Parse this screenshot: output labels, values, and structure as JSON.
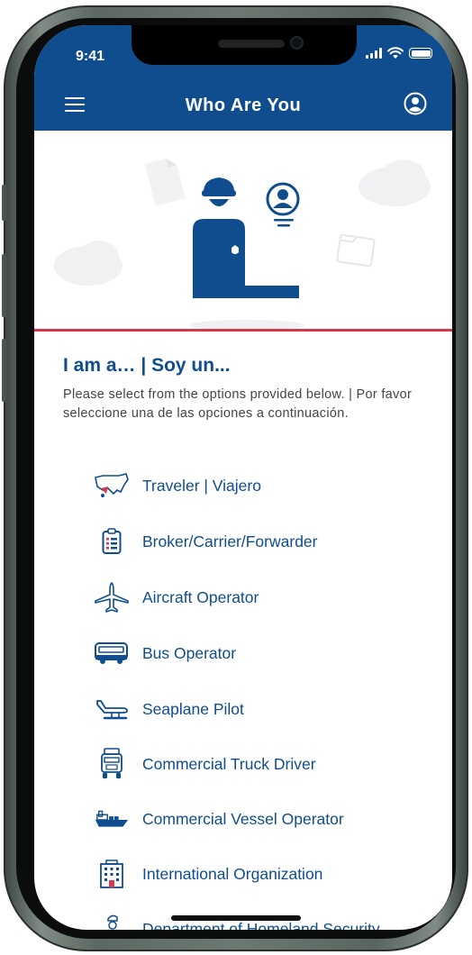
{
  "status_bar": {
    "time": "9:41"
  },
  "header": {
    "title": "Who Are You"
  },
  "section": {
    "title": "I am a… | Soy un...",
    "description": "Please select from the options provided below. | Por favor seleccione una de las opciones a continuación."
  },
  "options": [
    {
      "label": "Traveler | Viajero",
      "icon": "us-map-icon"
    },
    {
      "label": "Broker/Carrier/Forwarder",
      "icon": "clipboard-list-icon"
    },
    {
      "label": "Aircraft Operator",
      "icon": "airplane-icon"
    },
    {
      "label": "Bus Operator",
      "icon": "bus-icon"
    },
    {
      "label": "Seaplane Pilot",
      "icon": "seaplane-icon"
    },
    {
      "label": "Commercial Truck Driver",
      "icon": "truck-icon"
    },
    {
      "label": "Commercial Vessel Operator",
      "icon": "ship-icon"
    },
    {
      "label": "International Organization",
      "icon": "building-icon"
    },
    {
      "label": "Department of Homeland Security",
      "icon": "dhs-officer-icon"
    }
  ],
  "colors": {
    "brand_blue": "#0f4d8e",
    "accent_red": "#d6394e"
  }
}
